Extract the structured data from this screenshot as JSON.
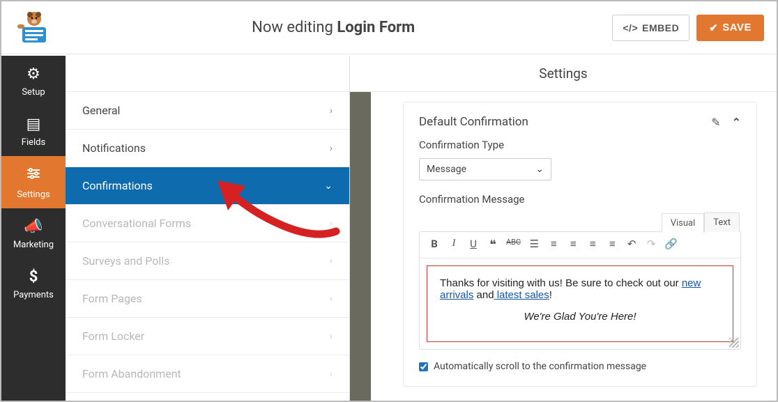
{
  "header": {
    "editing_prefix": "Now editing ",
    "form_name": "Login Form",
    "embed_label": "EMBED",
    "save_label": "SAVE"
  },
  "rail": {
    "items": [
      {
        "label": "Setup",
        "icon": "⚙"
      },
      {
        "label": "Fields",
        "icon": "▤"
      },
      {
        "label": "Settings",
        "icon": "⚙",
        "active": true
      },
      {
        "label": "Marketing",
        "icon": "📣"
      },
      {
        "label": "Payments",
        "icon": "$"
      }
    ]
  },
  "settings_menu": {
    "heading": "Settings",
    "items": [
      {
        "label": "General"
      },
      {
        "label": "Notifications"
      },
      {
        "label": "Confirmations",
        "active": true
      },
      {
        "label": "Conversational Forms",
        "disabled": true
      },
      {
        "label": "Surveys and Polls",
        "disabled": true
      },
      {
        "label": "Form Pages",
        "disabled": true
      },
      {
        "label": "Form Locker",
        "disabled": true
      },
      {
        "label": "Form Abandonment",
        "disabled": true
      }
    ]
  },
  "panel": {
    "title": "Default Confirmation",
    "type_label": "Confirmation Type",
    "type_value": "Message",
    "message_label": "Confirmation Message",
    "tabs": {
      "visual": "Visual",
      "text": "Text"
    },
    "body_prefix": "Thanks for visiting with us! Be sure to check out our ",
    "link1": "new arrivals",
    "mid": " and",
    "link2": " latest sales",
    "suffix": "!",
    "line2": "We're Glad You're Here!",
    "scroll_label": "Automatically scroll to the confirmation message",
    "scroll_checked": true
  }
}
